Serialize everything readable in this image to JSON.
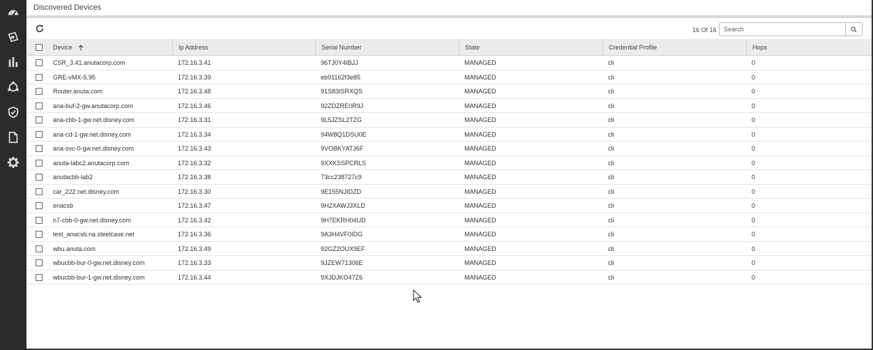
{
  "window": {
    "title": "Discovered Devices"
  },
  "toolbar": {
    "count_text": "16 Of 16",
    "search_placeholder": "Search"
  },
  "table": {
    "columns": [
      "Device",
      "Ip Address",
      "Serial Number",
      "State",
      "Credential Profile",
      "Hops"
    ],
    "rows": [
      {
        "device": "CSR_3.41.anutacorp.com",
        "ip": "172.16.3.41",
        "serial": "96TJ0Y4IBJJ",
        "state": "MANAGED",
        "profile": "cli",
        "hops": "0"
      },
      {
        "device": "GRE-vMX-5.95",
        "ip": "172.16.3.39",
        "serial": "eb91162f3e85",
        "state": "MANAGED",
        "profile": "cli",
        "hops": "0"
      },
      {
        "device": "Router.anuta.com",
        "ip": "172.16.3.48",
        "serial": "91S83ISRXQS",
        "state": "MANAGED",
        "profile": "cli",
        "hops": "0"
      },
      {
        "device": "ana-buf-2-gw.anutacorp.com",
        "ip": "172.16.3.46",
        "serial": "92ZDZRE0R9J",
        "state": "MANAGED",
        "profile": "cli",
        "hops": "0"
      },
      {
        "device": "ana-cbb-1-gw.net.disney.com",
        "ip": "172.16.3.31",
        "serial": "9L5JZSL2TZG",
        "state": "MANAGED",
        "profile": "cli",
        "hops": "0"
      },
      {
        "device": "ana-cd-1-gw.net.disney.com",
        "ip": "172.16.3.34",
        "serial": "94W8Q1DSU0E",
        "state": "MANAGED",
        "profile": "cli",
        "hops": "0"
      },
      {
        "device": "ana-svc-0-gw.net.disney.com",
        "ip": "172.16.3.43",
        "serial": "9VOBKYATJ6F",
        "state": "MANAGED",
        "profile": "cli",
        "hops": "0"
      },
      {
        "device": "anuta-labc2.anutacorp.com",
        "ip": "172.16.3.32",
        "serial": "9XXKSSPCRLS",
        "state": "MANAGED",
        "profile": "cli",
        "hops": "0"
      },
      {
        "device": "anutacbb-lab2",
        "ip": "172.16.3.38",
        "serial": "73cc238727c9",
        "state": "MANAGED",
        "profile": "cli",
        "hops": "0"
      },
      {
        "device": "car_222.net.disney.com",
        "ip": "172.16.3.30",
        "serial": "9E155NJIDZD",
        "state": "MANAGED",
        "profile": "cli",
        "hops": "0"
      },
      {
        "device": "enacsb",
        "ip": "172.16.3.47",
        "serial": "9H2XAWJ3XLD",
        "state": "MANAGED",
        "profile": "cli",
        "hops": "0"
      },
      {
        "device": "n7-cbb-0-gw.net.disney.com",
        "ip": "172.16.3.42",
        "serial": "9H7EKRH04UD",
        "state": "MANAGED",
        "profile": "cli",
        "hops": "0"
      },
      {
        "device": "test_anacsb.na.steelcase.net",
        "ip": "172.16.3.36",
        "serial": "9A3H4VF0IDG",
        "state": "MANAGED",
        "profile": "cli",
        "hops": "0"
      },
      {
        "device": "wbu.anuta.com",
        "ip": "172.16.3.49",
        "serial": "92GZ2OUX9EF",
        "state": "MANAGED",
        "profile": "cli",
        "hops": "0"
      },
      {
        "device": "wbucbb-bur-0-gw.net.disney.com",
        "ip": "172.16.3.33",
        "serial": "9JZEW71306E",
        "state": "MANAGED",
        "profile": "cli",
        "hops": "0"
      },
      {
        "device": "wbucbb-bur-1-gw.net.disney.com",
        "ip": "172.16.3.44",
        "serial": "9XJDJKO47Z6",
        "state": "MANAGED",
        "profile": "cli",
        "hops": "0"
      }
    ]
  },
  "icons": {
    "sidebar": [
      "dashboard-icon",
      "devices-icon",
      "bar-chart-icon",
      "network-icon",
      "shield-check-icon",
      "document-icon",
      "settings-gear-icon"
    ],
    "toolbar": [
      "refresh-icon",
      "search-icon"
    ],
    "header": [
      "checkbox-icon",
      "sort-ascending-icon"
    ]
  },
  "colors": {
    "sidebar_bg": "#2b2b2b",
    "header_bg": "#ececec"
  }
}
